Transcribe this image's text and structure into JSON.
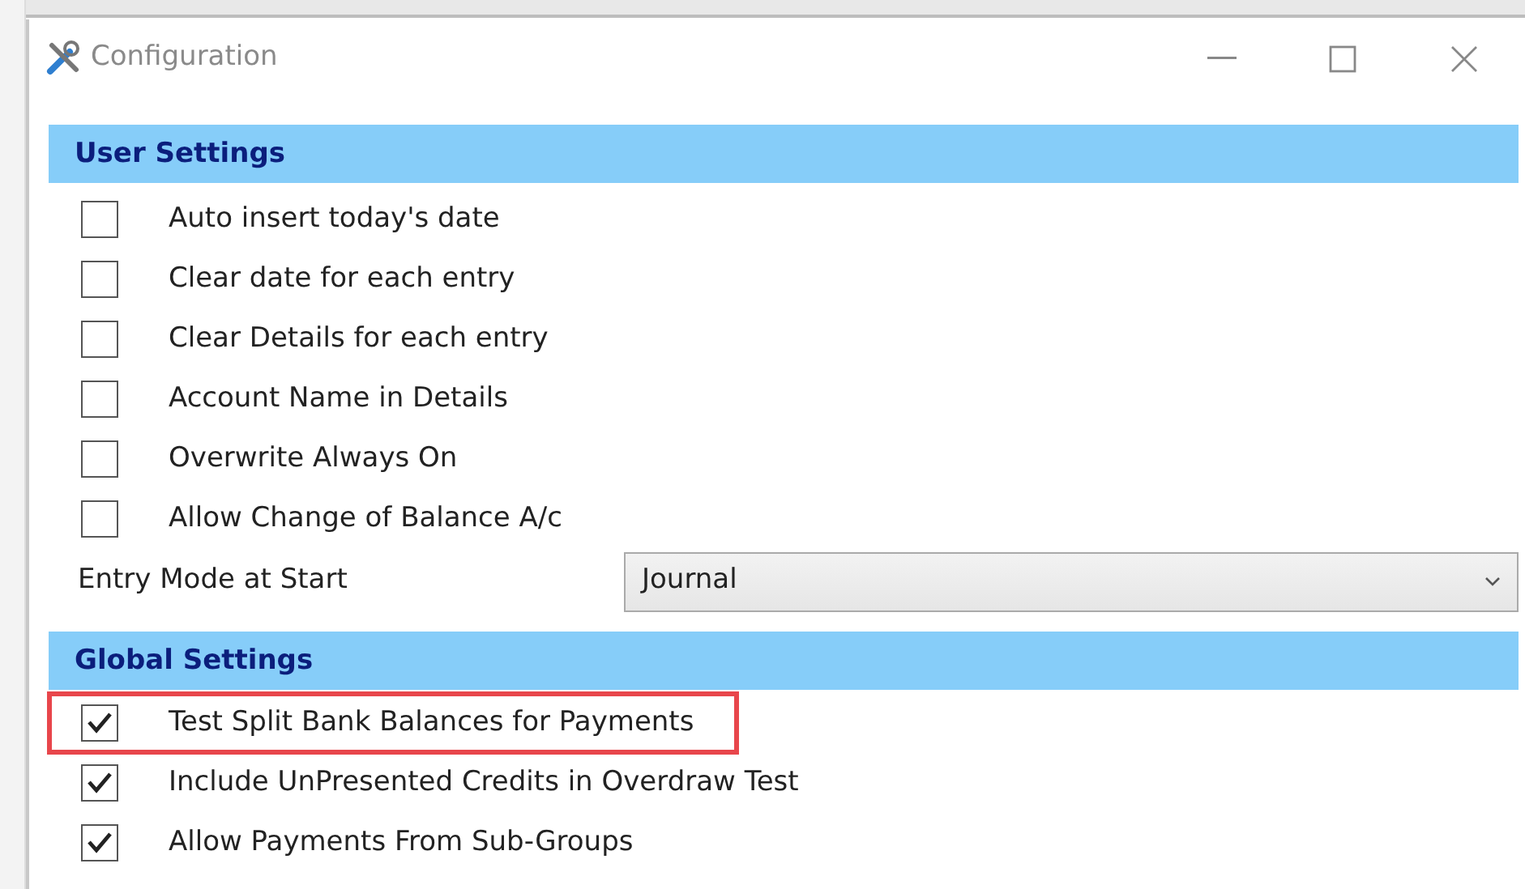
{
  "window": {
    "title": "Configuration"
  },
  "sections": [
    {
      "title": "User Settings",
      "items": [
        {
          "kind": "checkbox",
          "label": "Auto insert today's date",
          "checked": false,
          "highlighted": false
        },
        {
          "kind": "checkbox",
          "label": "Clear date for each entry",
          "checked": false,
          "highlighted": false
        },
        {
          "kind": "checkbox",
          "label": "Clear Details for each entry",
          "checked": false,
          "highlighted": false
        },
        {
          "kind": "checkbox",
          "label": "Account Name in Details",
          "checked": false,
          "highlighted": false
        },
        {
          "kind": "checkbox",
          "label": "Overwrite Always On",
          "checked": false,
          "highlighted": false
        },
        {
          "kind": "checkbox",
          "label": "Allow Change of Balance A/c",
          "checked": false,
          "highlighted": false
        },
        {
          "kind": "select",
          "label": "Entry Mode at Start",
          "value": "Journal"
        }
      ]
    },
    {
      "title": "Global Settings",
      "items": [
        {
          "kind": "checkbox",
          "label": "Test Split Bank Balances for Payments",
          "checked": true,
          "highlighted": true
        },
        {
          "kind": "checkbox",
          "label": "Include UnPresented Credits in Overdraw Test",
          "checked": true,
          "highlighted": false
        },
        {
          "kind": "checkbox",
          "label": "Allow Payments From Sub-Groups",
          "checked": true,
          "highlighted": false
        }
      ]
    }
  ]
}
